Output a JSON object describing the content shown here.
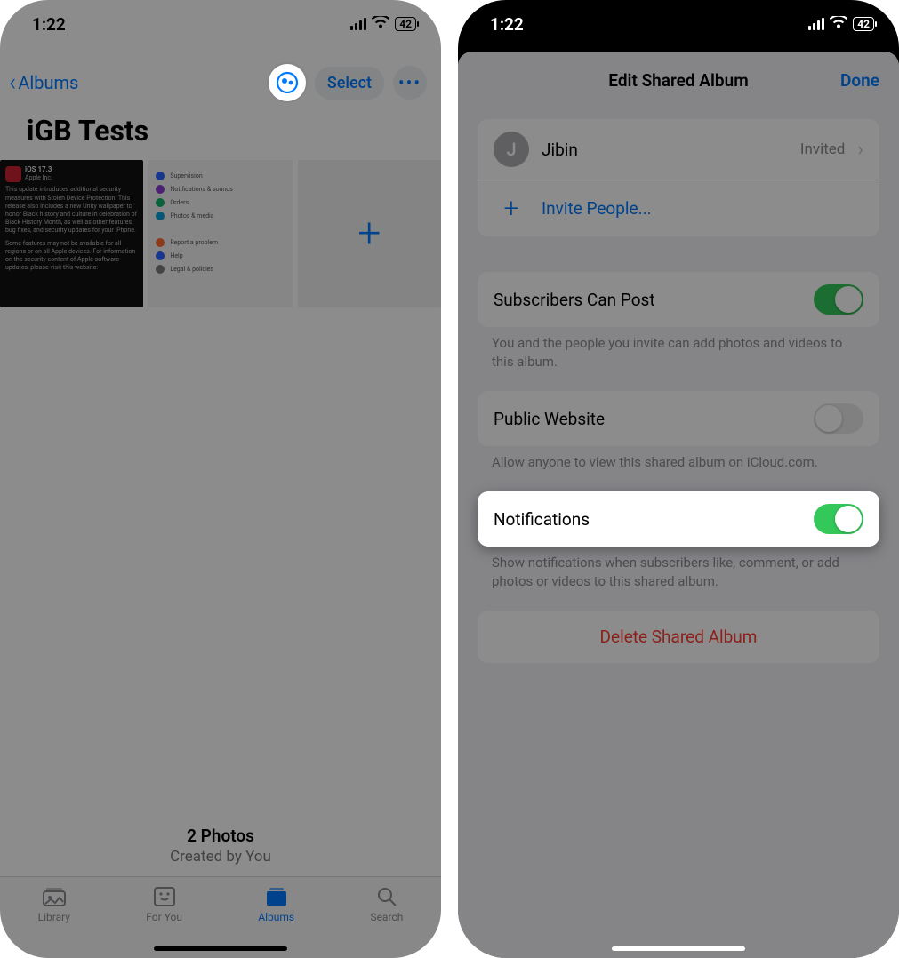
{
  "status": {
    "time": "1:22",
    "battery": "42"
  },
  "left": {
    "back_label": "Albums",
    "select_label": "Select",
    "album_title": "iGB Tests",
    "photo_count": "2 Photos",
    "created_by": "Created by You",
    "tabs": {
      "library": "Library",
      "for_you": "For You",
      "albums": "Albums",
      "search": "Search"
    },
    "thumbA": {
      "badge_title": "iOS 17.3",
      "badge_sub": "Apple Inc.",
      "body": "This update introduces additional security measures with Stolen Device Protection. This release also includes a new Unity wallpaper to honor Black history and culture in celebration of Black History Month, as well as other features, bug fixes, and security updates for your iPhone.",
      "body2": "Some features may not be available for all regions or on all Apple devices. For information on the security content of Apple software updates, please visit this website:"
    },
    "thumbB": {
      "items": [
        "Supervision",
        "Notifications & sounds",
        "Orders",
        "Photos & media",
        "Report a problem",
        "Help",
        "Legal & policies"
      ]
    }
  },
  "right": {
    "sheet_title": "Edit Shared Album",
    "done": "Done",
    "member_initial": "J",
    "member_name": "Jibin",
    "member_status": "Invited",
    "invite_label": "Invite People...",
    "subscribers_label": "Subscribers Can Post",
    "subscribers_foot": "You and the people you invite can add photos and videos to this album.",
    "public_label": "Public Website",
    "public_foot": "Allow anyone to view this shared album on iCloud.com.",
    "notifications_label": "Notifications",
    "notifications_foot": "Show notifications when subscribers like, comment, or add photos or videos to this shared album.",
    "delete_label": "Delete Shared Album"
  }
}
